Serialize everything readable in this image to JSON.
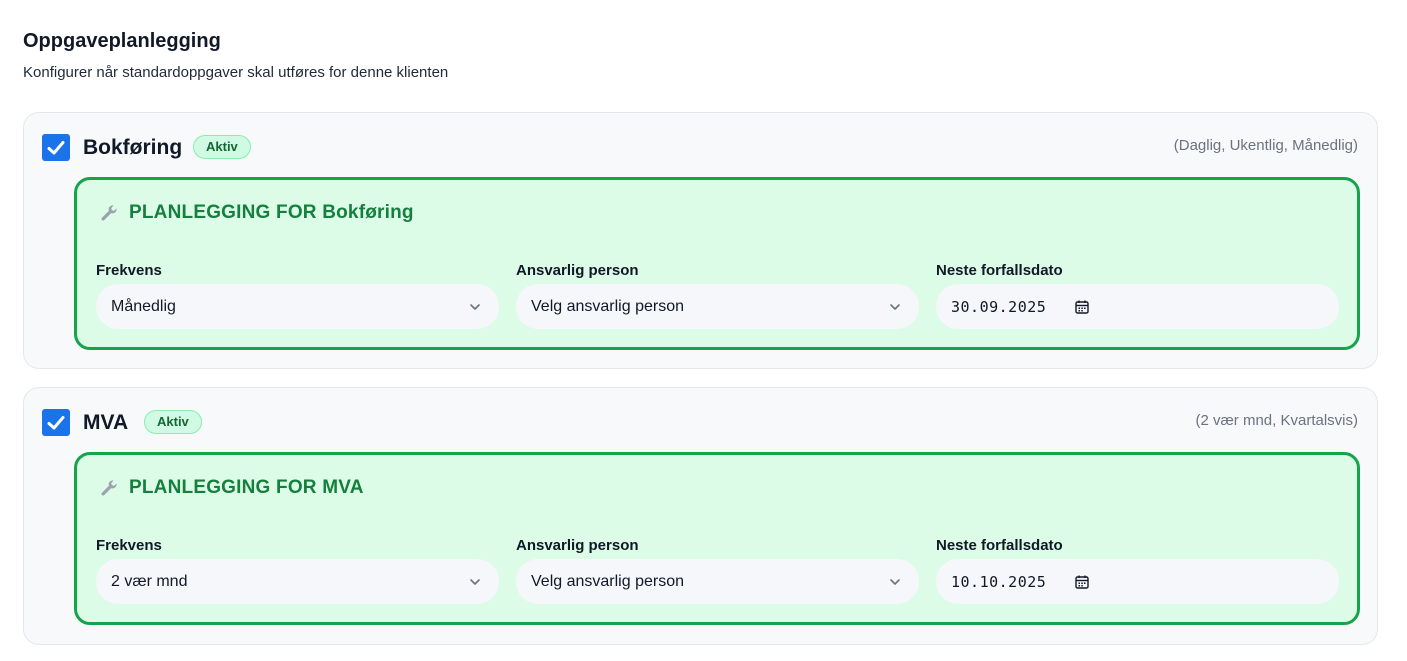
{
  "header": {
    "title": "Oppgaveplanlegging",
    "subtitle": "Konfigurer når standardoppgaver skal utføres for denne klienten"
  },
  "colors": {
    "checkbox": "#1a73e8",
    "badge_bg": "#d1fae5",
    "badge_text": "#166534",
    "plan_bg": "#dcfce7",
    "plan_border": "#16a34a",
    "plan_title": "#15803d"
  },
  "tasks": [
    {
      "checked": true,
      "name": "Bokføring",
      "badge": "Aktiv",
      "frequency_options": "(Daglig, Ukentlig, Månedlig)",
      "plan_title": "PLANLEGGING FOR Bokføring",
      "fields": {
        "frequency_label": "Frekvens",
        "frequency_value": "Månedlig",
        "responsible_label": "Ansvarlig person",
        "responsible_value": "Velg ansvarlig person",
        "due_label": "Neste forfallsdato",
        "due_value": "30.09.2025"
      }
    },
    {
      "checked": true,
      "name": "MVA",
      "badge": "Aktiv",
      "frequency_options": "(2 vær mnd, Kvartalsvis)",
      "plan_title": "PLANLEGGING FOR MVA",
      "fields": {
        "frequency_label": "Frekvens",
        "frequency_value": "2 vær mnd",
        "responsible_label": "Ansvarlig person",
        "responsible_value": "Velg ansvarlig person",
        "due_label": "Neste forfallsdato",
        "due_value": "10.10.2025"
      }
    }
  ]
}
